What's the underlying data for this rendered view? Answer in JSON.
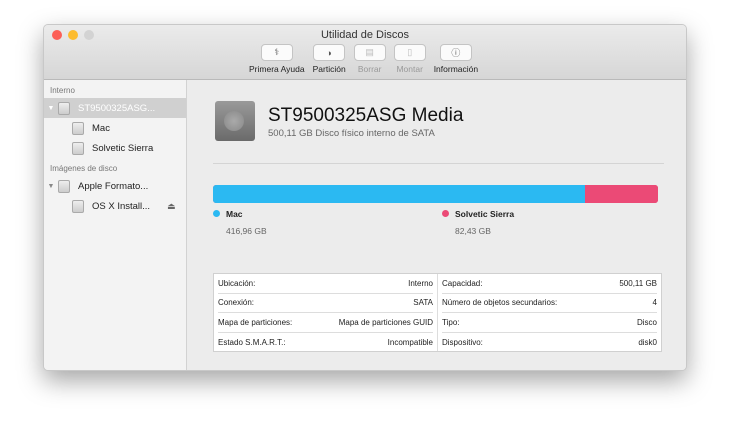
{
  "window": {
    "title": "Utilidad de Discos"
  },
  "toolbar": [
    {
      "label": "Primera Ayuda",
      "icon": "stethoscope-icon",
      "glyph": "⚕",
      "enabled": true
    },
    {
      "label": "Partición",
      "icon": "partition-icon",
      "glyph": "◑",
      "enabled": true
    },
    {
      "label": "Borrar",
      "icon": "erase-icon",
      "glyph": "▤",
      "enabled": false
    },
    {
      "label": "Montar",
      "icon": "mount-icon",
      "glyph": "▯",
      "enabled": false
    },
    {
      "label": "Información",
      "icon": "info-icon",
      "glyph": "ⓘ",
      "enabled": true
    }
  ],
  "sidebar": {
    "section_internal": "Interno",
    "disk": "ST9500325ASG...",
    "volumes": [
      "Mac",
      "Solvetic Sierra"
    ],
    "section_images": "Imágenes de disco",
    "image": "Apple Formato...",
    "image_volume": "OS X Install...",
    "eject": "⏏"
  },
  "disk": {
    "name": "ST9500325ASG Media",
    "subtitle": "500,11 GB Disco físico interno de SATA"
  },
  "usage": {
    "partitions": [
      {
        "name": "Mac",
        "size": "416,96 GB",
        "gb": 416.96,
        "color": "#2bb9f2"
      },
      {
        "name": "Solvetic Sierra",
        "size": "82,43 GB",
        "gb": 82.43,
        "color": "#eb4a76"
      }
    ]
  },
  "info": {
    "left": [
      [
        "Ubicación:",
        "Interno"
      ],
      [
        "Conexión:",
        "SATA"
      ],
      [
        "Mapa de particiones:",
        "Mapa de particiones GUID"
      ],
      [
        "Estado S.M.A.R.T.:",
        "Incompatible"
      ]
    ],
    "right": [
      [
        "Capacidad:",
        "500,11 GB"
      ],
      [
        "Número de objetos secundarios:",
        "4"
      ],
      [
        "Tipo:",
        "Disco"
      ],
      [
        "Dispositivo:",
        "disk0"
      ]
    ]
  }
}
